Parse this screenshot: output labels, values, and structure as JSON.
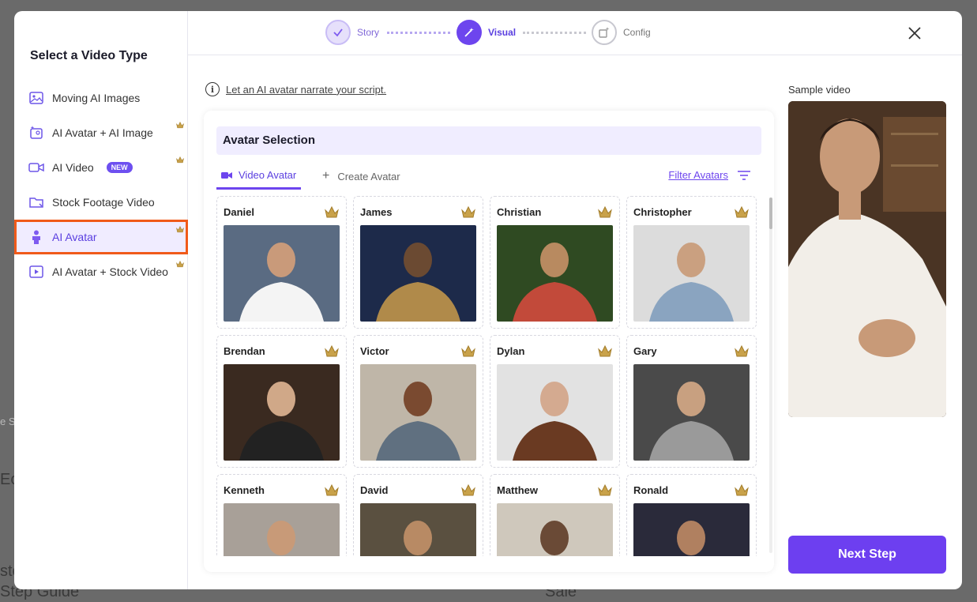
{
  "background": {
    "text_lines": [
      "e S",
      "Ec",
      "ste",
      "Step Guide",
      "Sale"
    ]
  },
  "sidebar": {
    "title": "Select a Video Type",
    "items": [
      {
        "label": "Moving AI Images",
        "icon": "image-icon",
        "premium": false,
        "badge": ""
      },
      {
        "label": "AI Avatar + AI Image",
        "icon": "sparkle-image-icon",
        "premium": true,
        "badge": ""
      },
      {
        "label": "AI Video",
        "icon": "video-camera-icon",
        "premium": true,
        "badge": "NEW"
      },
      {
        "label": "Stock Footage Video",
        "icon": "folder-icon",
        "premium": false,
        "badge": ""
      },
      {
        "label": "AI Avatar",
        "icon": "person-icon",
        "premium": true,
        "badge": "",
        "active": true
      },
      {
        "label": "AI Avatar + Stock Video",
        "icon": "video-avatar-icon",
        "premium": true,
        "badge": ""
      }
    ]
  },
  "stepper": {
    "steps": [
      {
        "label": "Story",
        "state": "done"
      },
      {
        "label": "Visual",
        "state": "active"
      },
      {
        "label": "Config",
        "state": "todo"
      }
    ]
  },
  "intro": {
    "text": "Let an AI avatar narrate your script."
  },
  "panel": {
    "title": "Avatar Selection",
    "tabs": [
      {
        "label": "Video Avatar",
        "active": true
      },
      {
        "label": "Create Avatar",
        "active": false
      }
    ],
    "filter_label": "Filter Avatars"
  },
  "avatars": [
    {
      "name": "Daniel"
    },
    {
      "name": "James"
    },
    {
      "name": "Christian"
    },
    {
      "name": "Christopher"
    },
    {
      "name": "Brendan"
    },
    {
      "name": "Victor"
    },
    {
      "name": "Dylan"
    },
    {
      "name": "Gary"
    },
    {
      "name": "Kenneth"
    },
    {
      "name": "David"
    },
    {
      "name": "Matthew"
    },
    {
      "name": "Ronald"
    }
  ],
  "sample": {
    "label": "Sample video"
  },
  "next_button": {
    "label": "Next Step"
  },
  "colors": {
    "accent": "#6d3ff0",
    "highlight_outline": "#f05a1a",
    "crown": "#c9a24a"
  }
}
